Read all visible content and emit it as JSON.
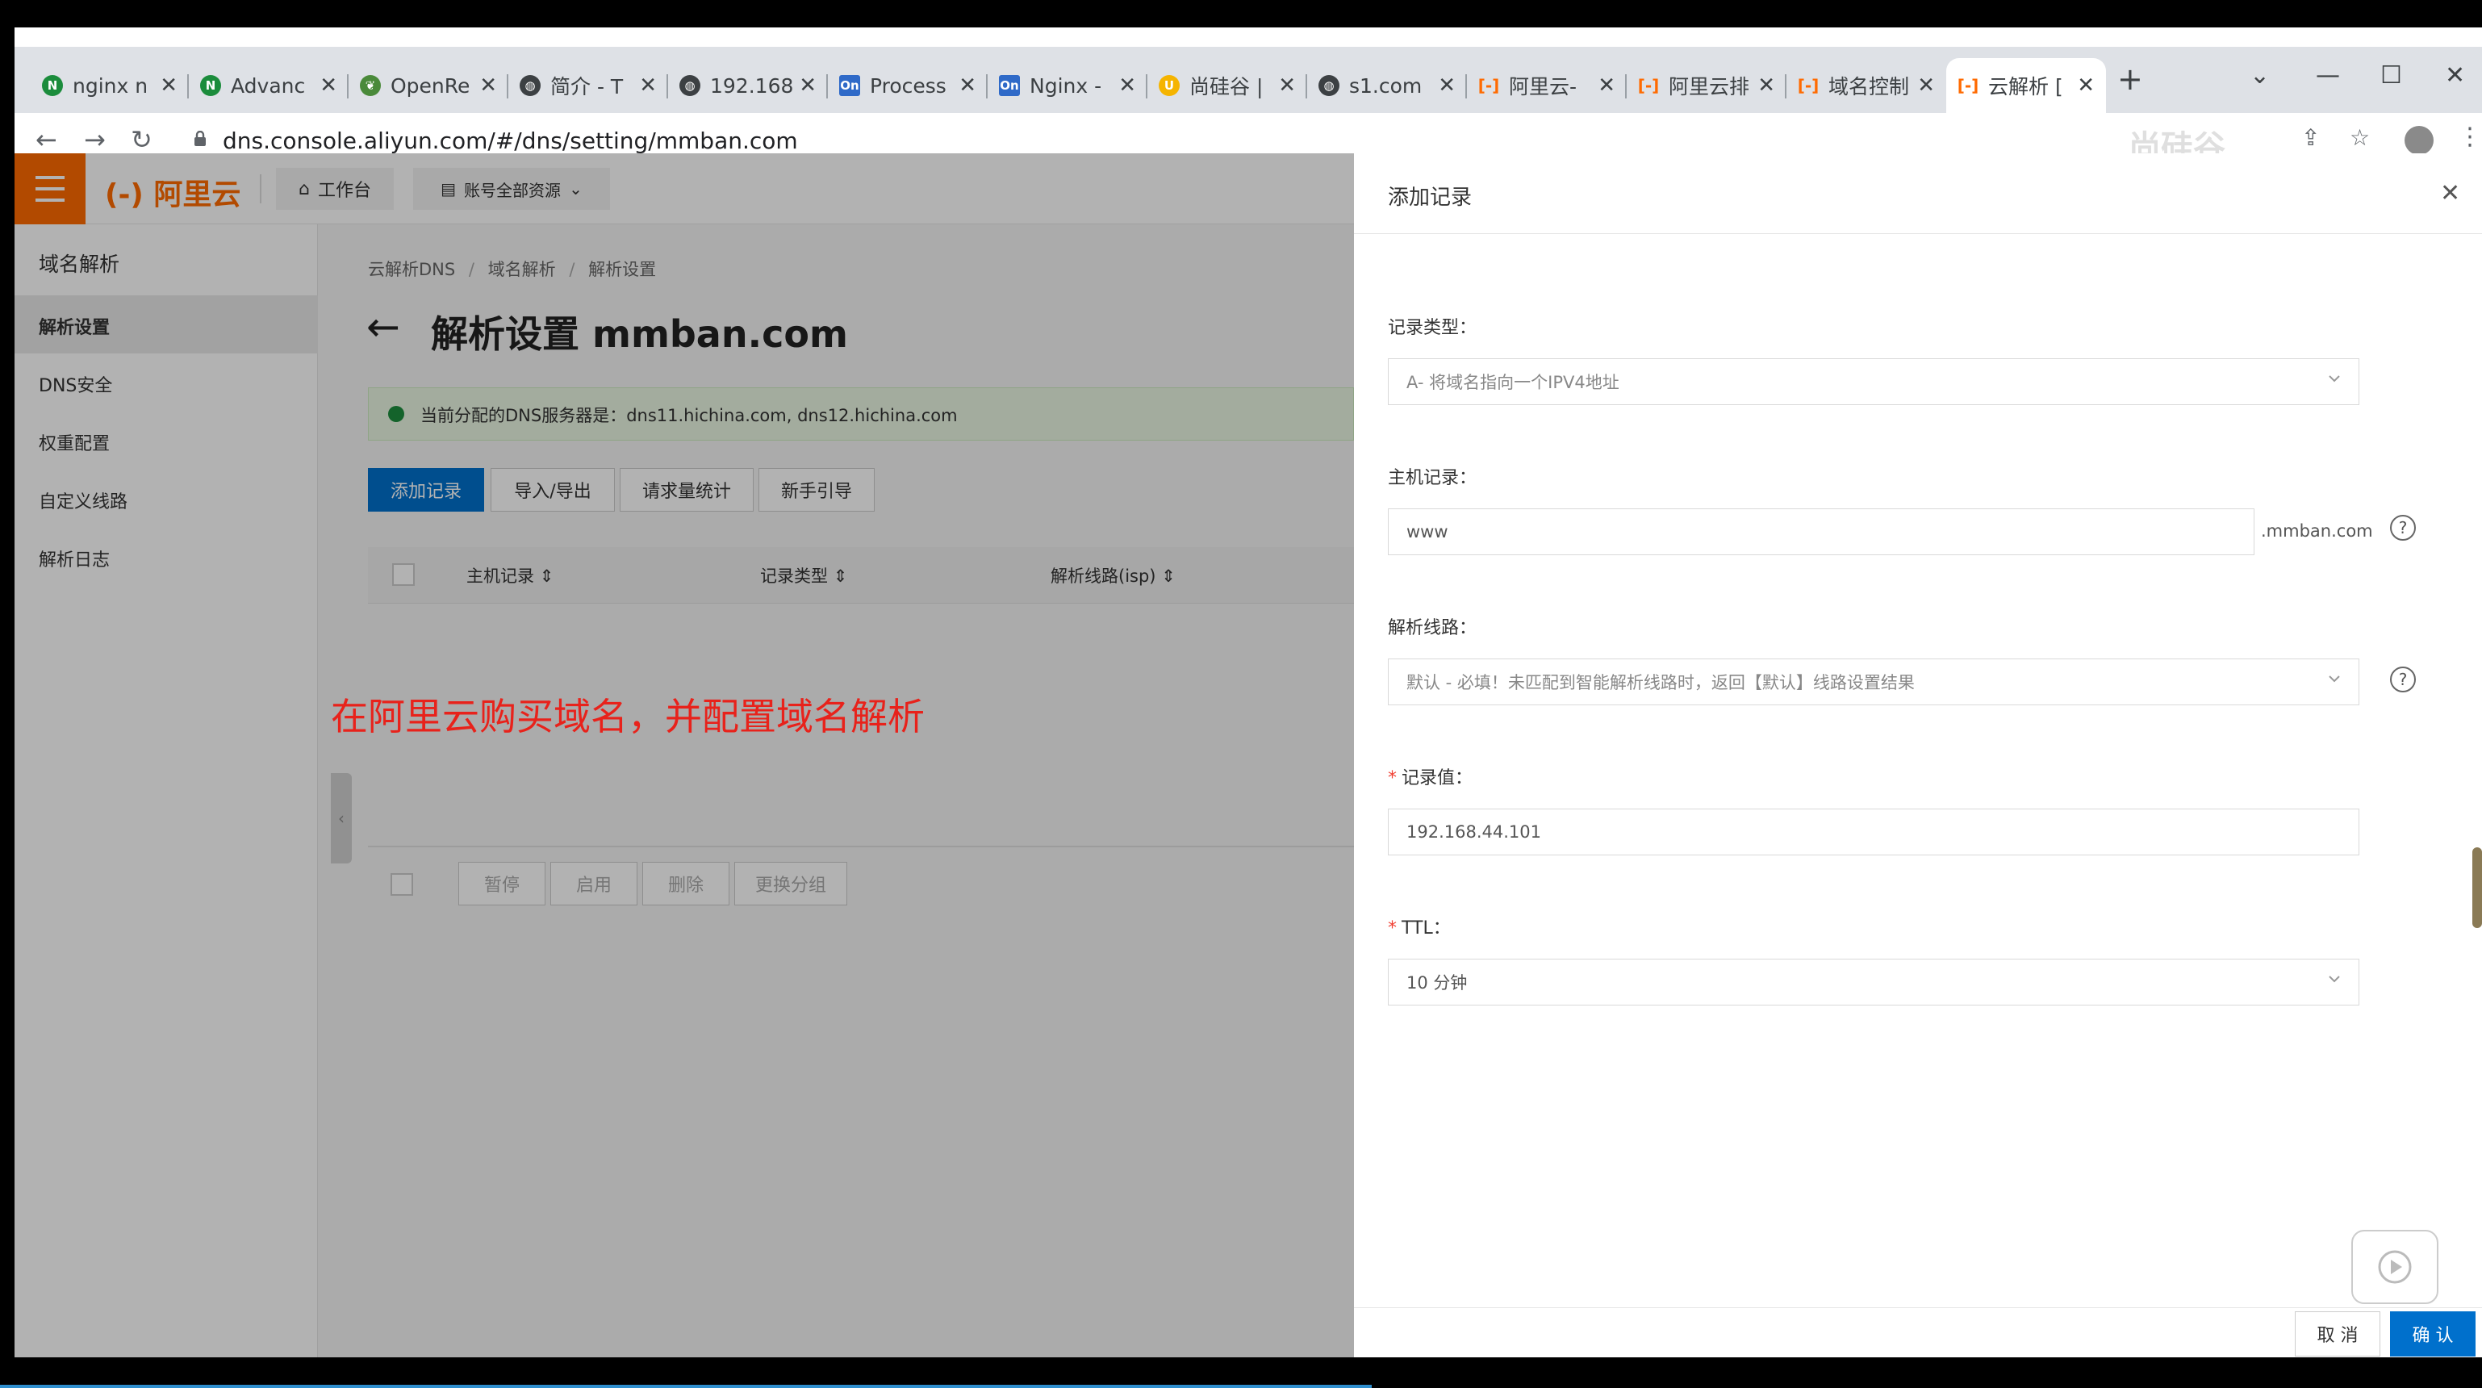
{
  "browser": {
    "tabs": [
      {
        "title": "nginx n",
        "icon": "nginx-icon",
        "color": "#1b8c3c"
      },
      {
        "title": "Advanc",
        "icon": "nginx-icon",
        "color": "#1b8c3c"
      },
      {
        "title": "OpenRe",
        "icon": "openresty-icon",
        "color": "#4a8a3a"
      },
      {
        "title": "简介 - T",
        "icon": "globe-icon",
        "color": "#3c4043"
      },
      {
        "title": "192.168",
        "icon": "globe-icon",
        "color": "#3c4043"
      },
      {
        "title": "Process",
        "icon": "on-icon",
        "color": "#2f6ac8"
      },
      {
        "title": "Nginx -",
        "icon": "on-icon",
        "color": "#2f6ac8"
      },
      {
        "title": "尚硅谷 |",
        "icon": "atguigu-icon",
        "color": "#f5b400"
      },
      {
        "title": "s1.com",
        "icon": "globe-icon",
        "color": "#3c4043"
      },
      {
        "title": "阿里云-",
        "icon": "aliyun-icon",
        "color": "#ff6a00"
      },
      {
        "title": "阿里云排",
        "icon": "aliyun-icon",
        "color": "#ff6a00"
      },
      {
        "title": "域名控制",
        "icon": "aliyun-icon",
        "color": "#ff6a00"
      },
      {
        "title": "云解析 [",
        "icon": "aliyun-icon",
        "color": "#ff6a00"
      }
    ],
    "url": "dns.console.aliyun.com/#/dns/setting/mmban.com"
  },
  "console": {
    "logo_text": "阿里云",
    "workbench": "工作台",
    "resources": "账号全部资源",
    "sidebar_title": "域名解析",
    "sidebar_items": [
      "解析设置",
      "DNS安全",
      "权重配置",
      "自定义线路",
      "解析日志"
    ],
    "breadcrumb": [
      "云解析DNS",
      "域名解析",
      "解析设置"
    ],
    "page_title": "解析设置 mmban.com",
    "notice": "当前分配的DNS服务器是：dns11.hichina.com, dns12.hichina.com",
    "action_buttons": [
      "添加记录",
      "导入/导出",
      "请求量统计",
      "新手引导"
    ],
    "table_headers": [
      "主机记录",
      "记录类型",
      "解析线路(isp)"
    ],
    "batch_buttons": [
      "暂停",
      "启用",
      "删除",
      "更换分组"
    ]
  },
  "annotation": "在阿里云购买域名，并配置域名解析",
  "drawer": {
    "title": "添加记录",
    "record_type_label": "记录类型：",
    "record_type_value": "A- 将域名指向一个IPV4地址",
    "host_label": "主机记录：",
    "host_value": "www",
    "host_suffix": ".mmban.com",
    "line_label": "解析线路：",
    "line_value": "默认 - 必填！未匹配到智能解析线路时，返回【默认】线路设置结果",
    "value_label": "记录值：",
    "value_value": "192.168.44.101",
    "ttl_label": "TTL：",
    "ttl_value": "10 分钟",
    "cancel": "取 消",
    "confirm": "确 认"
  },
  "watermark": "尚硅谷"
}
